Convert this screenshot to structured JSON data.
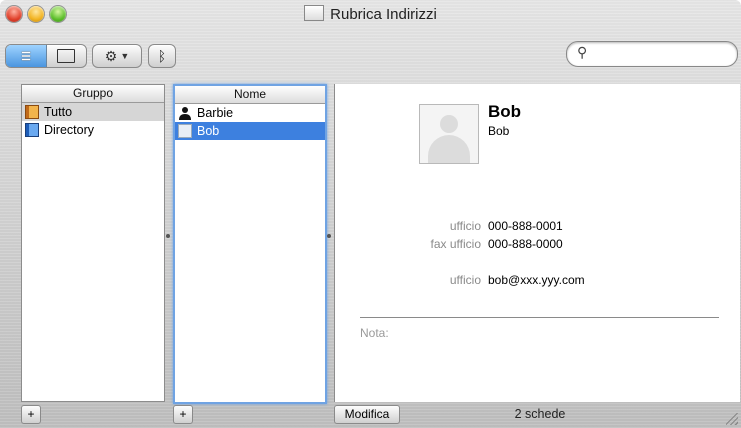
{
  "window": {
    "title": "Rubrica Indirizzi"
  },
  "toolbar": {
    "view_columns_icon": "columns-view-icon",
    "view_card_icon": "card-view-icon",
    "action_icon": "gear-icon",
    "bluetooth_icon": "bluetooth-icon",
    "search_placeholder": "",
    "search_icon": "search-icon"
  },
  "groups": {
    "header": "Gruppo",
    "items": [
      {
        "label": "Tutto",
        "icon": "address-book-icon",
        "selected": true
      },
      {
        "label": "Directory",
        "icon": "directory-icon",
        "selected": false
      }
    ]
  },
  "names": {
    "header": "Nome",
    "items": [
      {
        "label": "Barbie",
        "icon": "person-icon",
        "selected": false
      },
      {
        "label": "Bob",
        "icon": "card-icon",
        "selected": true
      }
    ]
  },
  "card": {
    "name": "Bob",
    "subname": "Bob",
    "fields": [
      {
        "label": "ufficio",
        "value": "000-888-0001"
      },
      {
        "label": "fax ufficio",
        "value": "000-888-0000"
      },
      {
        "label": "ufficio",
        "value": "bob@xxx.yyy.com"
      }
    ],
    "note_label": "Nota:"
  },
  "bottom": {
    "add_group": "+",
    "add_person": "+",
    "edit_label": "Modifica",
    "count": "2 schede"
  },
  "colors": {
    "selection_blue": "#3d80df",
    "selection_gray": "#d6d6d6",
    "focus_ring": "#6fa3e3"
  }
}
